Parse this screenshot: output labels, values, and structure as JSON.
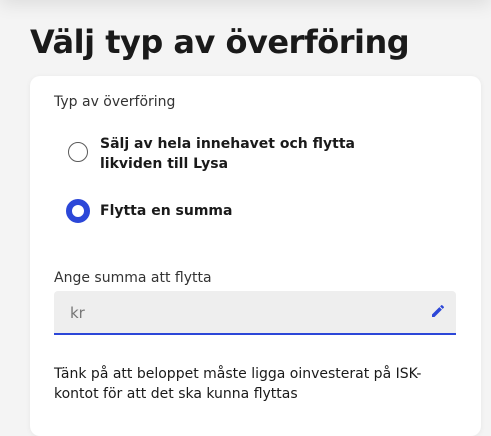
{
  "page": {
    "title": "Välj typ av överföring"
  },
  "transfer_type": {
    "legend": "Typ av överföring",
    "options": [
      {
        "label": "Sälj av hela innehavet och flytta likviden till Lysa",
        "selected": false
      },
      {
        "label": "Flytta en summa",
        "selected": true
      }
    ]
  },
  "amount": {
    "label": "Ange summa att flytta",
    "placeholder": "kr",
    "value": ""
  },
  "info": {
    "text": "Tänk på att beloppet måste ligga oinvesterat på ISK-kontot för att det ska kunna flyttas"
  },
  "colors": {
    "accent": "#2c47d8",
    "card_bg": "#ffffff",
    "page_bg": "#f4f4f4",
    "input_bg": "#eeeeee"
  },
  "icons": {
    "edit": "pencil-icon"
  }
}
